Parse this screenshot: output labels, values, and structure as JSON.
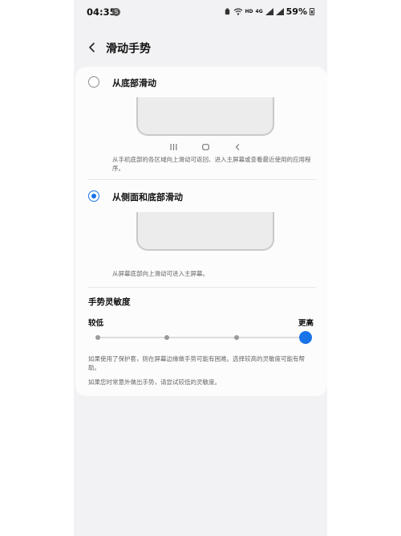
{
  "status_bar": {
    "time": "04:35",
    "notif_badge": "S",
    "hd_label": "HD",
    "network_label": "4G",
    "battery": "59%"
  },
  "header": {
    "title": "滑动手势"
  },
  "options": [
    {
      "label": "从底部滑动",
      "selected": false,
      "description": "从手机底部的各区域向上滑动可返回、进入主屏幕或查看最近使用的应用程序。"
    },
    {
      "label": "从侧面和底部滑动",
      "selected": true,
      "description": "从屏幕底部向上滑动可进入主屏幕。"
    }
  ],
  "sensitivity": {
    "title": "手势灵敏度",
    "low_label": "较低",
    "high_label": "更高",
    "levels": 4,
    "selected_level": 4,
    "note1": "如果使用了保护套，则在屏幕边缘做手势可能有困难。选择较高的灵敏度可能有帮助。",
    "note2": "如果您时常意外做出手势，请尝试较低的灵敏度。"
  },
  "colors": {
    "accent": "#1a73e8"
  }
}
